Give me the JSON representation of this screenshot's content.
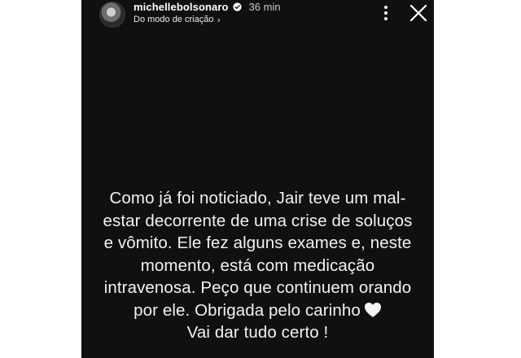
{
  "header": {
    "username": "michellebolsonaro",
    "verified_icon": "verified-badge-icon",
    "time": "36 min",
    "subtitle": "Do modo de criação",
    "chevron": "›",
    "more_icon": "more-options-icon",
    "close_icon": "close-icon"
  },
  "story": {
    "lines": [
      "Como já foi noticiado, Jair teve um mal-",
      "estar decorrente de uma crise de soluços",
      "e vômito. Ele fez alguns exames e, neste",
      "momento, está com medicação",
      "intravenosa. Peço que continuem orando",
      "por ele. Obrigada pelo carinho",
      "Vai dar tudo certo !"
    ],
    "emoji": "white-heart-icon"
  },
  "colors": {
    "story_background": "#101010",
    "text": "#f2f2f2",
    "page_background": "#ffffff"
  }
}
